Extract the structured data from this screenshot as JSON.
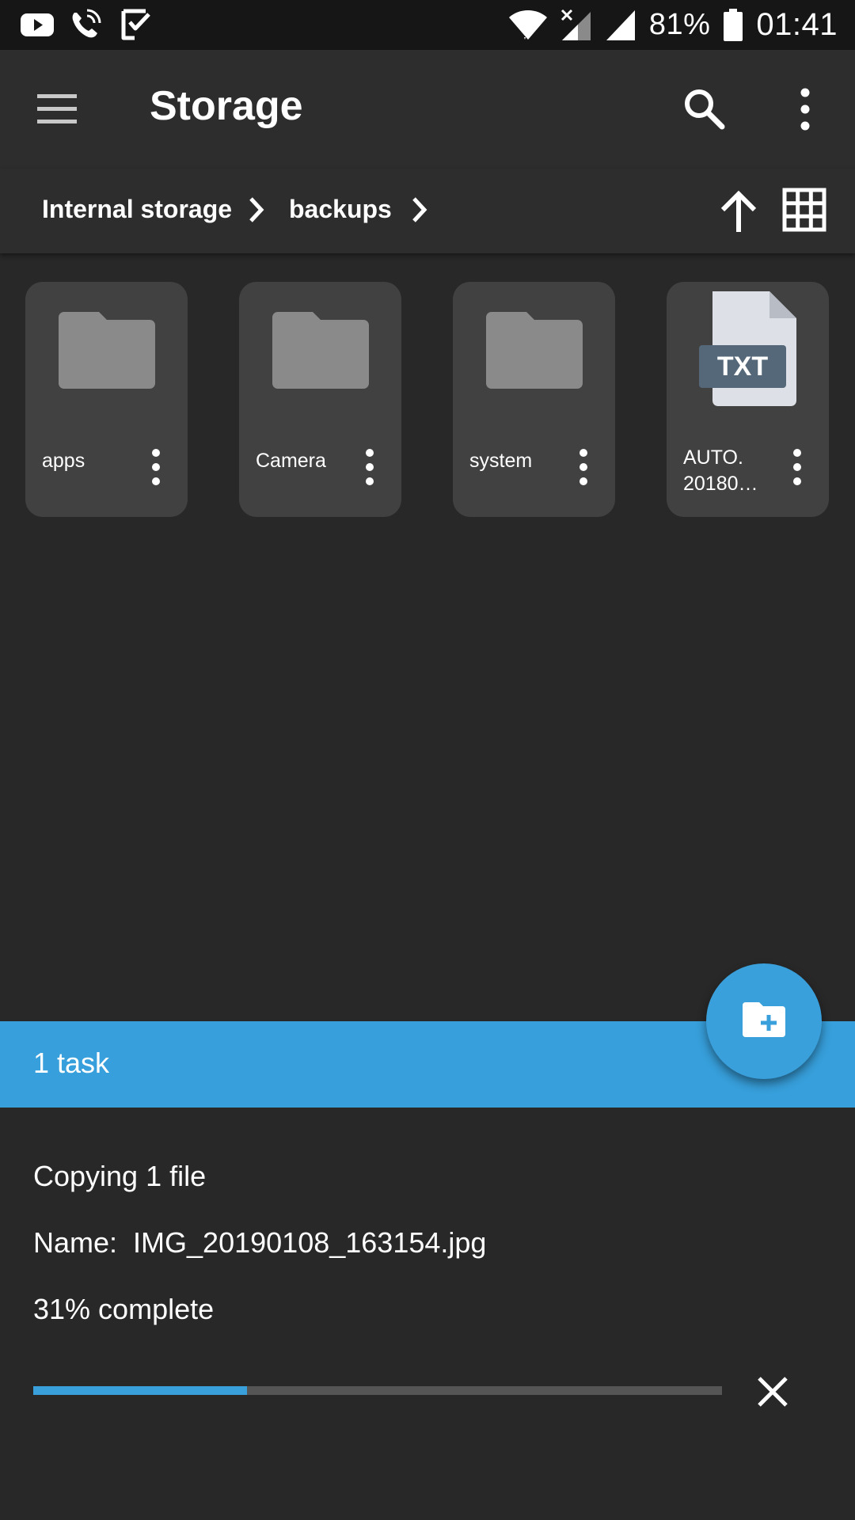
{
  "status_bar": {
    "battery_percent": "81%",
    "clock": "01:41",
    "left_icons": [
      "youtube-icon",
      "wifi-calling-icon",
      "checklist-icon"
    ],
    "right_icons": [
      "wifi-icon",
      "no-signal-icon",
      "signal-icon",
      "battery-icon"
    ]
  },
  "toolbar": {
    "title": "Storage",
    "icons": [
      "menu-icon",
      "search-icon",
      "more-vert-icon"
    ]
  },
  "breadcrumb": {
    "items": [
      "Internal storage",
      "backups"
    ],
    "icons": [
      "chevron-right-icon",
      "arrow-upward-icon",
      "grid-view-icon"
    ]
  },
  "files": [
    {
      "name": "apps",
      "kind": "folder"
    },
    {
      "name": "Camera",
      "kind": "folder"
    },
    {
      "name": "system",
      "kind": "folder"
    },
    {
      "name": "AUTO. 20180…",
      "kind": "file",
      "badge": "TXT"
    }
  ],
  "fab": {
    "icon": "create-new-folder-icon"
  },
  "task_panel": {
    "banner": "1 task",
    "operation": "Copying 1 file",
    "name_label": "Name:",
    "file_name": "IMG_20190108_163154.jpg",
    "progress_text": "31% complete",
    "progress_fraction": 0.31,
    "cancel_icon": "close-icon"
  },
  "colors": {
    "accent": "#379fdb",
    "background": "#282828",
    "toolbar": "#2d2d2d",
    "tile": "#414141",
    "folder": "#8a8a8a",
    "txt_badge": "#55687a"
  }
}
